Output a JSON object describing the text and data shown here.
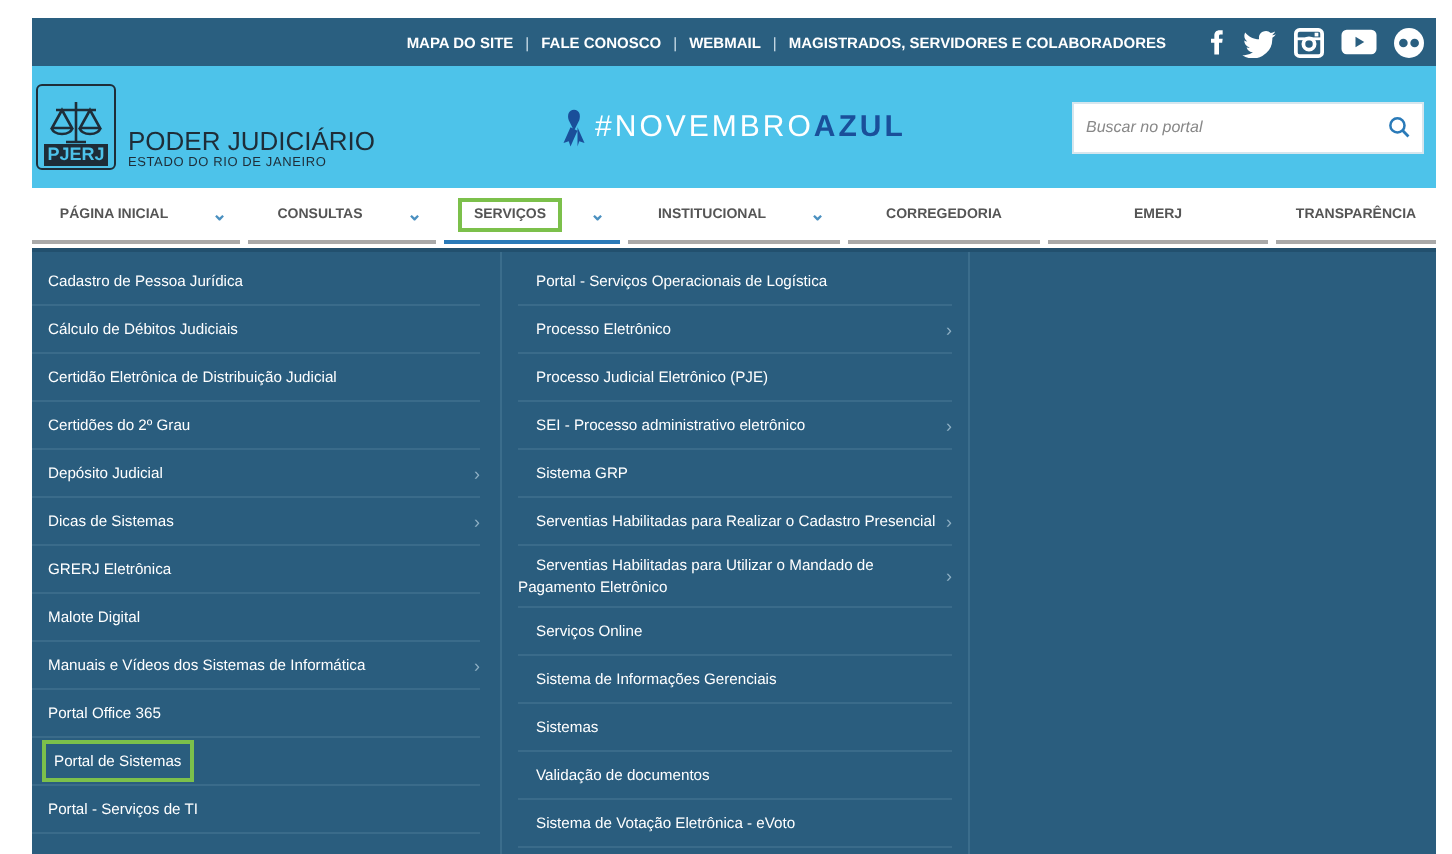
{
  "top_bar": {
    "links": [
      "MAPA DO SITE",
      "FALE CONOSCO",
      "WEBMAIL",
      "MAGISTRADOS, SERVIDORES E COLABORADORES"
    ],
    "separator": "|"
  },
  "header": {
    "logo_text": "PJERJ",
    "title": "PODER JUDICIÁRIO",
    "subtitle": "ESTADO DO RIO DE JANEIRO",
    "campaign": "#NOVEMBRO**AZUL**",
    "search": {
      "placeholder": "Buscar no portal"
    }
  },
  "nav": [
    {
      "label": "PÁGINA INICIAL",
      "caret": true,
      "highlighted": false,
      "selected": false
    },
    {
      "label": "CONSULTAS",
      "caret": true,
      "highlighted": false,
      "selected": false
    },
    {
      "label": "SERVIÇOS",
      "caret": true,
      "highlighted": true,
      "selected": true
    },
    {
      "label": "INSTITUCIONAL",
      "caret": true,
      "highlighted": false,
      "selected": false
    },
    {
      "label": "CORREGEDORIA",
      "caret": false,
      "highlighted": false,
      "selected": false
    },
    {
      "label": "EMERJ",
      "caret": false,
      "highlighted": false,
      "selected": false
    },
    {
      "label": "TRANSPARÊNCIA",
      "caret": false,
      "highlighted": false,
      "selected": false
    }
  ],
  "menu_columns": [
    [
      {
        "label": "Cadastro de Pessoa Jurídica",
        "submenu": false,
        "highlighted": false
      },
      {
        "label": "Cálculo de Débitos Judiciais",
        "submenu": false,
        "highlighted": false
      },
      {
        "label": "Certidão Eletrônica de Distribuição Judicial",
        "submenu": false,
        "highlighted": false
      },
      {
        "label": "Certidões do 2º Grau",
        "submenu": false,
        "highlighted": false
      },
      {
        "label": "Depósito Judicial",
        "submenu": true,
        "highlighted": false
      },
      {
        "label": "Dicas de Sistemas",
        "submenu": true,
        "highlighted": false
      },
      {
        "label": "GRERJ Eletrônica",
        "submenu": false,
        "highlighted": false
      },
      {
        "label": "Malote Digital",
        "submenu": false,
        "highlighted": false
      },
      {
        "label": "Manuais e Vídeos dos Sistemas de Informática",
        "submenu": true,
        "highlighted": false
      },
      {
        "label": "Portal Office 365",
        "submenu": false,
        "highlighted": false
      },
      {
        "label": "Portal de Sistemas",
        "submenu": false,
        "highlighted": true
      },
      {
        "label": "Portal - Serviços de TI",
        "submenu": false,
        "highlighted": false
      }
    ],
    [
      {
        "label": "Portal - Serviços Operacionais de Logística",
        "submenu": false,
        "highlighted": false
      },
      {
        "label": "Processo Eletrônico",
        "submenu": true,
        "highlighted": false
      },
      {
        "label": "Processo Judicial Eletrônico (PJE)",
        "submenu": false,
        "highlighted": false
      },
      {
        "label": "SEI - Processo administrativo eletrônico",
        "submenu": true,
        "highlighted": false
      },
      {
        "label": "Sistema GRP",
        "submenu": false,
        "highlighted": false
      },
      {
        "label": "Serventias Habilitadas para Realizar o Cadastro Presencial",
        "submenu": true,
        "highlighted": false
      },
      {
        "label": "Serventias Habilitadas para Utilizar o Mandado de Pagamento Eletrônico",
        "submenu": true,
        "highlighted": false
      },
      {
        "label": "Serviços Online",
        "submenu": false,
        "highlighted": false
      },
      {
        "label": "Sistema de Informações Gerenciais",
        "submenu": false,
        "highlighted": false
      },
      {
        "label": "Sistemas",
        "submenu": false,
        "highlighted": false
      },
      {
        "label": "Validação de documentos",
        "submenu": false,
        "highlighted": false
      },
      {
        "label": "Sistema de Votação Eletrônica - eVoto",
        "submenu": false,
        "highlighted": false
      }
    ]
  ],
  "submenu_arrow": "›",
  "caret_glyph": "⌄"
}
